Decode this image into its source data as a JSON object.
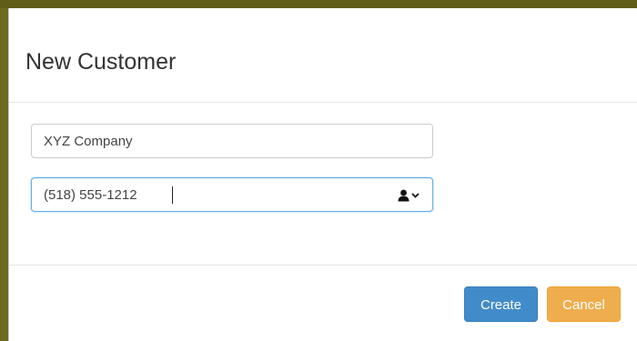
{
  "modal": {
    "title": "New Customer"
  },
  "form": {
    "company": {
      "value": "XYZ Company"
    },
    "phone": {
      "value": "(518) 555-1212",
      "contact_icon": "user-icon",
      "dropdown_icon": "chevron-down-icon"
    }
  },
  "footer": {
    "create_label": "Create",
    "cancel_label": "Cancel"
  },
  "colors": {
    "primary": "#428bca",
    "warning": "#f0ad4e",
    "backdrop": "#6b6a1f",
    "focus": "#66afe9"
  }
}
